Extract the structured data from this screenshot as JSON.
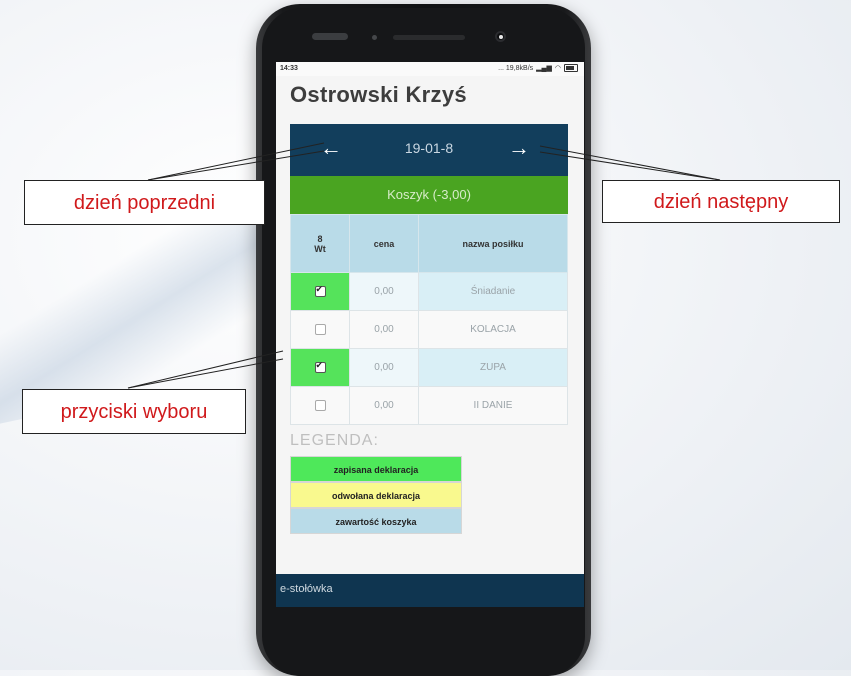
{
  "status_bar": {
    "time": "14:33",
    "indicators": "... 19,8kB/s"
  },
  "app": {
    "title": "Ostrowski Krzyś",
    "date": "19-01-8",
    "prev_arrow": "←",
    "next_arrow": "→",
    "basket_label": "Koszyk (-3,00)"
  },
  "table": {
    "headers": {
      "day_number": "8",
      "day_name": "Wt",
      "price": "cena",
      "name": "nazwa posiłku"
    },
    "rows": [
      {
        "checked": true,
        "price": "0,00",
        "name": "Śniadanie"
      },
      {
        "checked": false,
        "price": "0,00",
        "name": "KOLACJA"
      },
      {
        "checked": true,
        "price": "0,00",
        "name": "ZUPA"
      },
      {
        "checked": false,
        "price": "0,00",
        "name": "II DANIE"
      }
    ]
  },
  "legend": {
    "title": "LEGENDA:",
    "items": [
      {
        "label": "zapisana deklaracja",
        "color": "#4ee85a"
      },
      {
        "label": "odwołana deklaracja",
        "color": "#f9f98e"
      },
      {
        "label": "zawartość koszyka",
        "color": "#b9dbe8"
      }
    ]
  },
  "footer": {
    "label": "e-stołówka"
  },
  "annotations": {
    "prev_day": "dzień poprzedni",
    "next_day": "dzień następny",
    "choice_buttons": "przyciski wyboru"
  },
  "colors": {
    "nav_bg": "#123e5c",
    "basket_bg": "#4aa421",
    "checked_bg": "#55e35b",
    "annotation_text": "#d0191b"
  }
}
